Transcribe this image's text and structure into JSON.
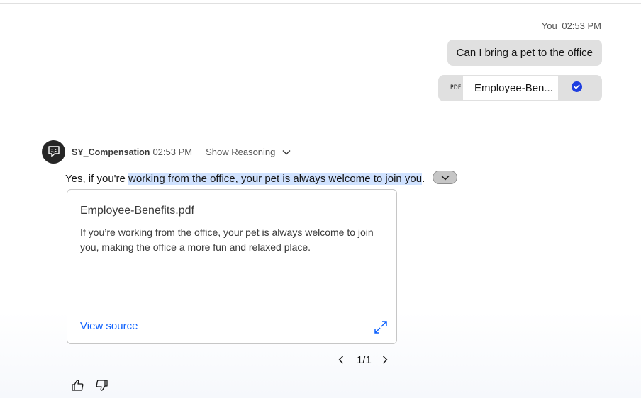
{
  "user_message": {
    "sender": "You",
    "time": "02:53 PM",
    "text": "Can I bring a pet to the office",
    "attachment": {
      "type_icon": "pdf-icon",
      "type_label": "PDF",
      "file_name": "Employee-Ben...",
      "status_icon": "checkmark-filled-icon",
      "status_color": "#1f3fe0"
    }
  },
  "bot_message": {
    "avatar_icon": "chat-bot-icon",
    "name": "SY_Compensation",
    "time": "02:53 PM",
    "reasoning_label": "Show Reasoning",
    "answer_prefix": "Yes, if you're ",
    "answer_highlight": "working from the office, your pet is always welcome to join you",
    "answer_suffix": ".",
    "highlight_color": "#d0e2ff",
    "citation": {
      "title": "Employee-Benefits.pdf",
      "excerpt": "If you’re working from the office, your pet is always welcome to join you, making the office a more fun and relaxed place.",
      "link_label": "View source",
      "link_color": "#0f62fe"
    },
    "pagination": {
      "label": "1/1"
    }
  }
}
